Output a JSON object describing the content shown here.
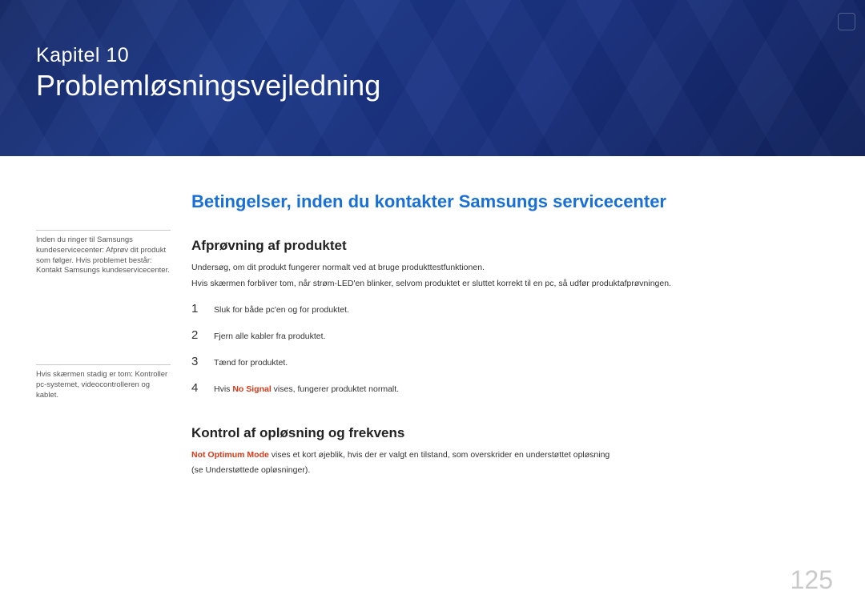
{
  "banner": {
    "chapter_label": "Kapitel  10",
    "chapter_title": "Problemløsningsvejledning"
  },
  "sidebar": {
    "note1": "Inden du ringer til Samsungs kundeservicecenter: Afprøv dit produkt som følger. Hvis problemet består: Kontakt Samsungs kundeservicecenter.",
    "note2": "Hvis skærmen stadig er tom: Kontroller pc-systemet, videocontrolleren og kablet."
  },
  "main": {
    "heading": "Betingelser, inden du kontakter Samsungs servicecenter",
    "section1": {
      "title": "Afprøvning af produktet",
      "p1": "Undersøg, om dit produkt fungerer normalt ved at bruge produkttestfunktionen.",
      "p2": "Hvis skærmen forbliver tom, når strøm-LED'en blinker, selvom produktet er sluttet korrekt til en pc, så udfør produktafprøvningen.",
      "steps": [
        {
          "n": "1",
          "text": "Sluk for både pc'en og for produktet."
        },
        {
          "n": "2",
          "text": "Fjern alle kabler fra produktet."
        },
        {
          "n": "3",
          "text": "Tænd for produktet."
        },
        {
          "n": "4",
          "prefix": "Hvis ",
          "warn": "No Signal",
          "suffix": " vises, fungerer produktet normalt."
        }
      ]
    },
    "section2": {
      "title": "Kontrol af opløsning og frekvens",
      "warn": "Not Optimum Mode",
      "p1_suffix": " vises et kort øjeblik, hvis der er valgt en tilstand, som overskrider en understøttet opløsning",
      "p2": "(se Understøttede opløsninger)."
    }
  },
  "page_number": "125"
}
